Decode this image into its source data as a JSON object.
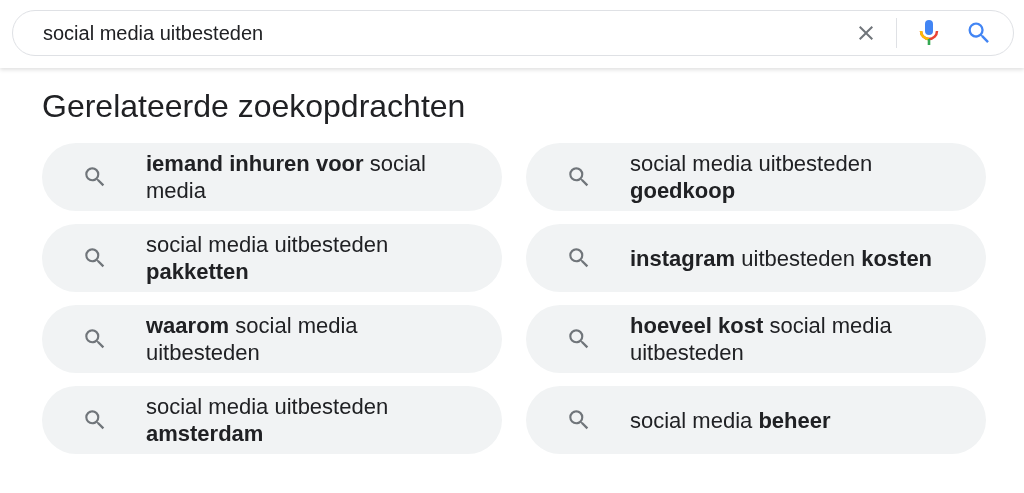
{
  "search": {
    "value": "social media uitbesteden"
  },
  "related": {
    "title": "Gerelateerde zoekopdrachten",
    "items": [
      {
        "text": "**iemand inhuren voor** social media"
      },
      {
        "text": "social media uitbesteden **goedkoop**"
      },
      {
        "text": "social media uitbesteden **pakketten**"
      },
      {
        "text": "**instagram** uitbesteden **kosten**"
      },
      {
        "text": "**waarom** social media uitbesteden"
      },
      {
        "text": "**hoeveel kost** social media uitbesteden"
      },
      {
        "text": "social media uitbesteden **amsterdam**"
      },
      {
        "text": "social media **beheer**"
      }
    ]
  }
}
